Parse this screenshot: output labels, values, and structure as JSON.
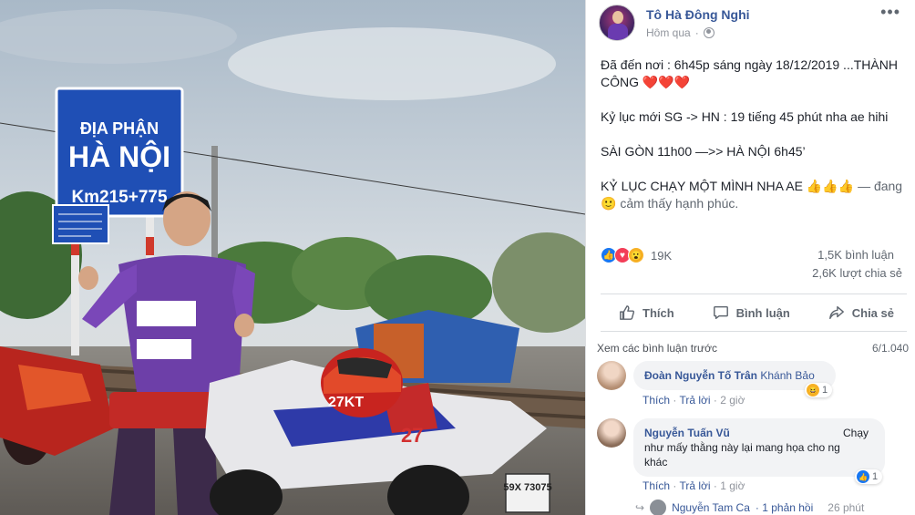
{
  "post": {
    "author": "Tô Hà Đông Nghi",
    "time": "Hôm qua",
    "more_label": "•••",
    "lines": {
      "l1a": "Đã đến nơi : 6h45p sáng ngày 18/12/2019 ...THÀNH CÔNG",
      "l1b": "❤️❤️❤️",
      "l2": "Kỷ lục mới SG -> HN : 19 tiếng 45 phút nha ae hihi",
      "l3": "SÀI GÒN 11h00 —>> HÀ NỘI 6h45’",
      "l4a": "KỶ LỤC CHẠY MỘT MÌNH NHA AE",
      "l4b": "👍👍👍",
      "l4c": "— đang",
      "l4d": "🙂",
      "l4e": "cảm thấy hạnh phúc."
    },
    "reactions_count": "19K",
    "comments_count": "1,5K bình luận",
    "shares_count": "2,6K lượt chia sẻ",
    "actions": {
      "like": "Thích",
      "comment": "Bình luận",
      "share": "Chia sẻ"
    }
  },
  "comments_section": {
    "view_previous": "Xem các bình luận trước",
    "counter": "6/1.040"
  },
  "comments": [
    {
      "name": "Đoàn Nguyễn Tố Trân",
      "tag": "Khánh Bảo",
      "text": "",
      "like": "Thích",
      "reply": "Trả lời",
      "time": "2 giờ",
      "reaction_count": "1",
      "reaction_emoji": "😆"
    },
    {
      "name": "Nguyễn Tuấn Vũ",
      "tag": "",
      "text_line1": "Chạy",
      "text_line2": "như mấy thằng này lại mang họa cho ng",
      "text_line3": "khác",
      "like": "Thích",
      "reply": "Trả lời",
      "time": "1 giờ",
      "reaction_count": "1",
      "reaction_emoji": "👍"
    }
  ],
  "reply_preview": {
    "name": "Nguyễn Tam Ca",
    "replies": "· 1 phản hồi",
    "time": "26 phút"
  },
  "photo": {
    "sign": {
      "line1": "ĐỊA PHẬN",
      "line2": "HÀ NỘI",
      "line3": "Km215+775"
    },
    "helmet_number": "27KT",
    "bike_number": "27",
    "plate": "59X 73075"
  },
  "colors": {
    "link": "#385898",
    "meta": "#90949c",
    "sign_blue": "#1f4fb5"
  }
}
